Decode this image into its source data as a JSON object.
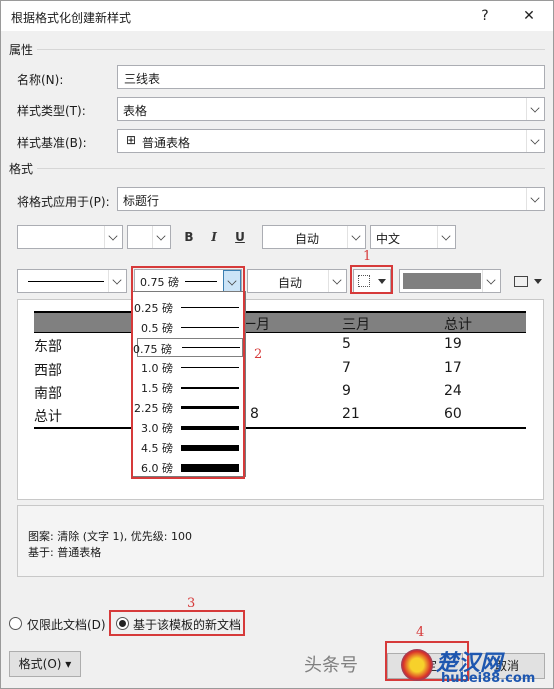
{
  "window": {
    "title": "根据格式化创建新样式",
    "help": "?",
    "close": "✕"
  },
  "properties": {
    "section": "属性",
    "name_label": "名称(N):",
    "name_value": "三线表",
    "type_label": "样式类型(T):",
    "type_value": "表格",
    "based_label": "样式基准(B):",
    "based_value": "普通表格"
  },
  "format": {
    "section": "格式",
    "apply_label": "将格式应用于(P):",
    "apply_value": "标题行",
    "bold": "B",
    "italic": "I",
    "underline": "U",
    "color_value": "自动",
    "lang_value": "中文",
    "border_weight_value": "0.75 磅",
    "border_color_value": "自动"
  },
  "preview": {
    "header": [
      "",
      "一月",
      "三月",
      "总计"
    ],
    "rows": [
      [
        "东部",
        "",
        "5",
        "19"
      ],
      [
        "西部",
        "",
        "7",
        "17"
      ],
      [
        "南部",
        "",
        "9",
        "24"
      ],
      [
        "总计",
        "8",
        "21",
        "60"
      ]
    ]
  },
  "weights_dropdown": [
    {
      "label": "0.25 磅",
      "thickness": 0.25
    },
    {
      "label": "0.5 磅",
      "thickness": 0.5
    },
    {
      "label": "0.75 磅",
      "thickness": 0.75
    },
    {
      "label": "1.0 磅",
      "thickness": 1.0
    },
    {
      "label": "1.5 磅",
      "thickness": 1.5
    },
    {
      "label": "2.25 磅",
      "thickness": 2.25
    },
    {
      "label": "3.0 磅",
      "thickness": 3.0
    },
    {
      "label": "4.5 磅",
      "thickness": 4.5
    },
    {
      "label": "6.0 磅",
      "thickness": 6.0
    }
  ],
  "description": {
    "line1": "图案: 清除 (文字 1), 优先级: 100",
    "line2": "基于: 普通表格"
  },
  "options": {
    "only_this_doc": "仅限此文档(D)",
    "new_docs": "基于该模板的新文档"
  },
  "buttons": {
    "format": "格式(O)",
    "ok": "确定",
    "cancel": "取消"
  },
  "annotations": [
    "1",
    "2",
    "3",
    "4"
  ],
  "watermark": {
    "text1": "头条号",
    "text2": "楚汉网",
    "url": "hubei88.com"
  },
  "colors": {
    "accent_red": "#d63a3a",
    "border_gray": "#abadb3",
    "preview_header": "#808080"
  }
}
